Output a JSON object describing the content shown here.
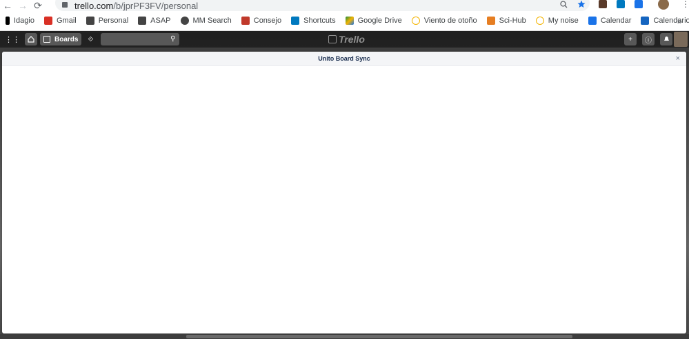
{
  "browser": {
    "url_domain": "trello.com",
    "url_path": "/b/jprPF3FV/personal",
    "nav": {
      "back": "←",
      "forward": "→",
      "reload": "⟳"
    }
  },
  "bookmarks": [
    {
      "label": "Idagio",
      "color": "#000000"
    },
    {
      "label": "Gmail",
      "color": "#d93025"
    },
    {
      "label": "Personal",
      "color": "#444444"
    },
    {
      "label": "ASAP",
      "color": "#444444"
    },
    {
      "label": "MM Search",
      "color": "#444444"
    },
    {
      "label": "Consejo",
      "color": "#c0392b"
    },
    {
      "label": "Shortcuts",
      "color": "#0079bf"
    },
    {
      "label": "Google Drive",
      "color": "#1e8e3e"
    },
    {
      "label": "Viento de otoño",
      "color": "#f4b400"
    },
    {
      "label": "Sci-Hub",
      "color": "#e67e22"
    },
    {
      "label": "My noise",
      "color": "#f4b400"
    },
    {
      "label": "Calendar",
      "color": "#1a73e8"
    },
    {
      "label": "Calendario",
      "color": "#1565c0"
    }
  ],
  "bookmarks_more": "»",
  "trello": {
    "boards_label": "Boards",
    "logo_text": "Trello"
  },
  "modal": {
    "title": "Unito Board Sync",
    "close": "×"
  }
}
